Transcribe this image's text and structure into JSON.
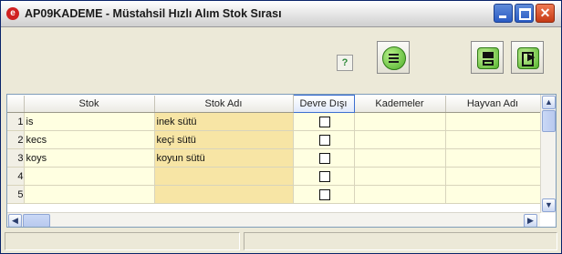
{
  "window": {
    "title": "AP09KADEME - Müstahsil Hızlı Alım Stok Sırası",
    "app_icon": "app-logo-icon",
    "controls": {
      "minimize": "minimize-icon",
      "maximize": "maximize-icon",
      "close": "close-icon"
    }
  },
  "toolbar": {
    "help_icon": "help-icon",
    "help_glyph": "?",
    "buttons": [
      {
        "name": "list-view",
        "icon": "list-icon"
      },
      {
        "name": "save",
        "icon": "floppy-disk-icon"
      },
      {
        "name": "exit",
        "icon": "exit-icon"
      }
    ]
  },
  "grid": {
    "columns": [
      "Stok",
      "Stok Adı",
      "Devre Dışı",
      "Kademeler",
      "Hayvan Adı"
    ],
    "rows": [
      {
        "n": "1",
        "stok": "is",
        "stok_adi": "inek sütü",
        "devre_disi": false,
        "kademeler": "",
        "hayvan_adi": ""
      },
      {
        "n": "2",
        "stok": "kecs",
        "stok_adi": "keçi sütü",
        "devre_disi": false,
        "kademeler": "",
        "hayvan_adi": ""
      },
      {
        "n": "3",
        "stok": "koys",
        "stok_adi": "koyun sütü",
        "devre_disi": false,
        "kademeler": "",
        "hayvan_adi": ""
      },
      {
        "n": "4",
        "stok": "",
        "stok_adi": "",
        "devre_disi": false,
        "kademeler": "",
        "hayvan_adi": ""
      },
      {
        "n": "5",
        "stok": "",
        "stok_adi": "",
        "devre_disi": false,
        "kademeler": "",
        "hayvan_adi": ""
      }
    ]
  },
  "colors": {
    "row_cell": "#ffffe1",
    "stok_adi_cell": "#f7e5a5",
    "title_close": "#c53a15",
    "title_button": "#2a5bc4",
    "active_header": "#3c6fd0"
  },
  "status": {
    "panel1": "",
    "panel2": ""
  }
}
